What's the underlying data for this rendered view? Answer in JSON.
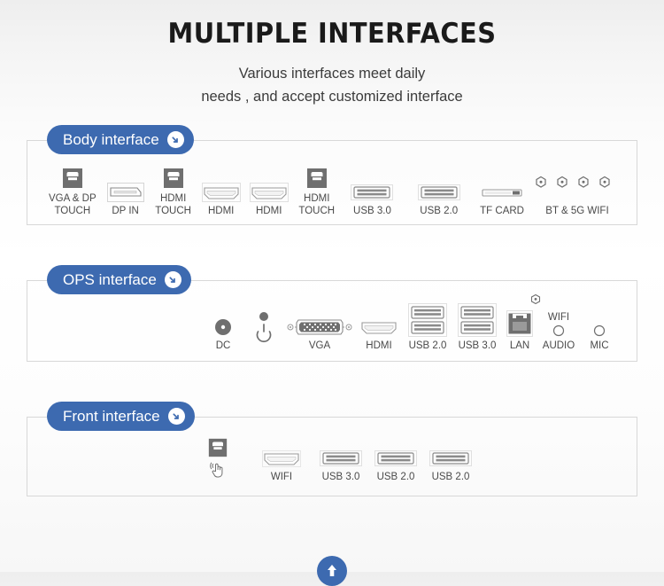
{
  "header": {
    "title": "MULTIPLE INTERFACES",
    "subtitle_line1": "Various interfaces meet daily",
    "subtitle_line2": "needs , and accept customized interface"
  },
  "theme": {
    "accent": "#3d6ab0",
    "icon_gray": "#6f6f6f",
    "panel_border": "#d8d8d8",
    "text": "#4a4a4a"
  },
  "sections": [
    {
      "badge_label": "Body interface",
      "badge_icon": "arrow-down-right-icon",
      "ports": [
        {
          "label": "VGA & DP\nTOUCH",
          "icon": "usb-b-filled-icon"
        },
        {
          "label": "DP IN",
          "icon": "displayport-icon"
        },
        {
          "label": "HDMI\nTOUCH",
          "icon": "usb-b-filled-icon"
        },
        {
          "label": "HDMI",
          "icon": "hdmi-icon"
        },
        {
          "label": "HDMI",
          "icon": "hdmi-icon"
        },
        {
          "label": "HDMI\nTOUCH",
          "icon": "usb-b-filled-icon"
        },
        {
          "label": "USB 3.0",
          "icon": "usb-a-icon"
        },
        {
          "label": "USB 2.0",
          "icon": "usb-a-icon"
        },
        {
          "label": "TF CARD",
          "icon": "tf-card-slot-icon"
        },
        {
          "label": "BT & 5G WIFI",
          "icon": "antenna-quad-icon"
        }
      ]
    },
    {
      "badge_label": "OPS interface",
      "badge_icon": "arrow-down-right-icon",
      "ports": [
        {
          "label": "DC",
          "icon": "dc-jack-icon"
        },
        {
          "label": "",
          "icon": "power-button-icon"
        },
        {
          "label": "VGA",
          "icon": "vga-dsub-icon"
        },
        {
          "label": "HDMI",
          "icon": "hdmi-icon"
        },
        {
          "label": "USB 2.0",
          "icon": "usb-a-dual-icon"
        },
        {
          "label": "USB 3.0",
          "icon": "usb-a-dual-icon"
        },
        {
          "label": "LAN",
          "icon": "rj45-lan-icon"
        },
        {
          "label": "AUDIO",
          "label_above": "WIFI",
          "icon": "audio-jack-icon"
        },
        {
          "label": "MIC",
          "icon": "audio-jack-icon"
        }
      ]
    },
    {
      "badge_label": "Front interface",
      "badge_icon": "arrow-down-right-icon",
      "ports": [
        {
          "label": "",
          "icon": "usb-b-touch-icon"
        },
        {
          "label": "WIFI",
          "icon": "hdmi-icon"
        },
        {
          "label": "USB 3.0",
          "icon": "usb-a-icon"
        },
        {
          "label": "USB 2.0",
          "icon": "usb-a-icon"
        },
        {
          "label": "USB 2.0",
          "icon": "usb-a-icon"
        }
      ]
    }
  ],
  "footer": {
    "scroll_icon": "scroll-up-circle-icon"
  }
}
